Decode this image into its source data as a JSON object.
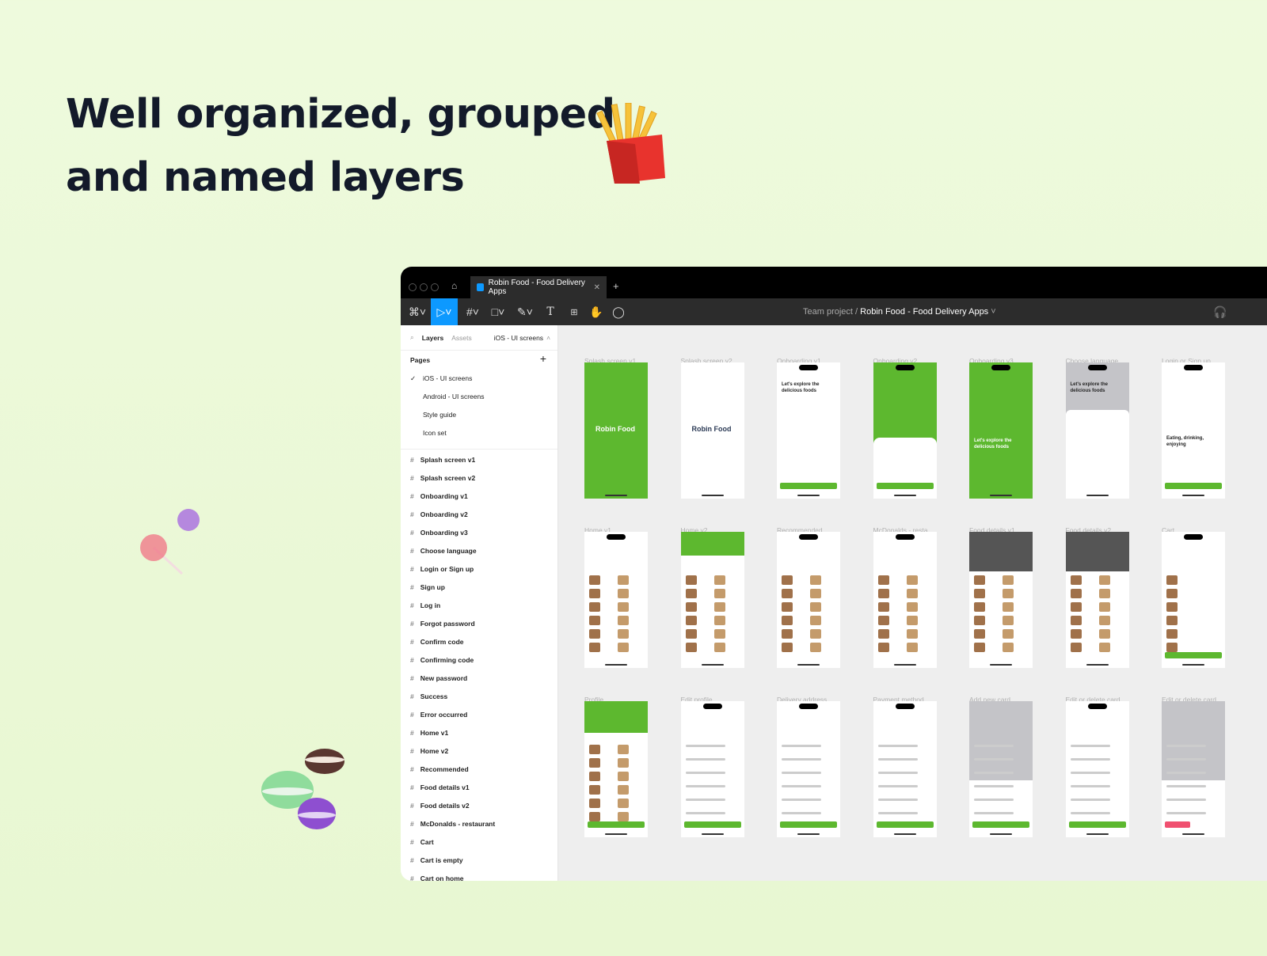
{
  "headline": [
    "Well organized, grouped",
    "and named layers"
  ],
  "colors": {
    "brand_green": "#5db82f",
    "accent_blue": "#0d99ff",
    "titlebar": "#000000",
    "toolbar": "#2c2c2c",
    "canvas": "#eeeeee"
  },
  "window": {
    "tab_title": "Robin Food - Food Delivery Apps",
    "breadcrumb_team": "Team project",
    "breadcrumb_file": "Robin Food - Food Delivery Apps"
  },
  "toolbar": {
    "icons": [
      "figma-menu-icon",
      "move-tool-icon",
      "frame-tool-icon",
      "shape-tool-icon",
      "pen-tool-icon",
      "text-tool-icon",
      "components-icon",
      "hand-tool-icon",
      "comment-icon"
    ]
  },
  "sidebar": {
    "tab_layers": "Layers",
    "tab_assets": "Assets",
    "page_selector": "iOS - UI screens",
    "pages_title": "Pages",
    "pages": [
      "iOS - UI screens",
      "Android - UI screens",
      "Style guide",
      "Icon set"
    ],
    "selected_page": "iOS - UI screens",
    "layers": [
      "Splash screen v1",
      "Splash screen v2",
      "Onboarding v1",
      "Onboarding v2",
      "Onboarding v3",
      "Choose language",
      "Login or Sign up",
      "Sign up",
      "Log in",
      "Forgot password",
      "Confirm code",
      "Confirming code",
      "New password",
      "Success",
      "Error occurred",
      "Home v1",
      "Home v2",
      "Recommended",
      "Food details v1",
      "Food details v2",
      "McDonalds - restaurant",
      "Cart",
      "Cart is empty",
      "Cart on home"
    ]
  },
  "frames": [
    {
      "label": "Splash screen v1",
      "bg": "#5db82f",
      "text": "Robin Food"
    },
    {
      "label": "Splash screen v2",
      "bg": "#ffffff",
      "text": "Robin Food"
    },
    {
      "label": "Onboarding v1",
      "bg": "#ffffff",
      "text": "Let's explore the delicious foods"
    },
    {
      "label": "Onboarding v2",
      "bg": "#5db82f",
      "text": "Let's explore the delicious foods"
    },
    {
      "label": "Onboarding v3",
      "bg": "#5db82f",
      "text": "Let's explore the delicious foods"
    },
    {
      "label": "Choose language",
      "bg": "#c4c4c8",
      "text": "Let's explore the delicious foods"
    },
    {
      "label": "Login or Sign up",
      "bg": "#ffffff",
      "text": "Eating, drinking, enjoying"
    },
    {
      "label": "Home v1",
      "bg": "#ffffff",
      "text": ""
    },
    {
      "label": "Home v2",
      "bg": "#ffffff",
      "text": ""
    },
    {
      "label": "Recommended",
      "bg": "#ffffff",
      "text": ""
    },
    {
      "label": "McDonalds - resta...",
      "bg": "#ffffff",
      "text": ""
    },
    {
      "label": "Food details v1",
      "bg": "#ffffff",
      "text": ""
    },
    {
      "label": "Food details v2",
      "bg": "#ffffff",
      "text": ""
    },
    {
      "label": "Cart",
      "bg": "#ffffff",
      "text": ""
    },
    {
      "label": "Profile",
      "bg": "#ffffff",
      "text": ""
    },
    {
      "label": "Edit profile",
      "bg": "#ffffff",
      "text": ""
    },
    {
      "label": "Delivery address",
      "bg": "#ffffff",
      "text": ""
    },
    {
      "label": "Payment method",
      "bg": "#ffffff",
      "text": ""
    },
    {
      "label": "Add new card",
      "bg": "#ffffff",
      "text": ""
    },
    {
      "label": "Edit or delete card",
      "bg": "#ffffff",
      "text": ""
    },
    {
      "label": "Edit or delete card...",
      "bg": "#ffffff",
      "text": ""
    }
  ]
}
